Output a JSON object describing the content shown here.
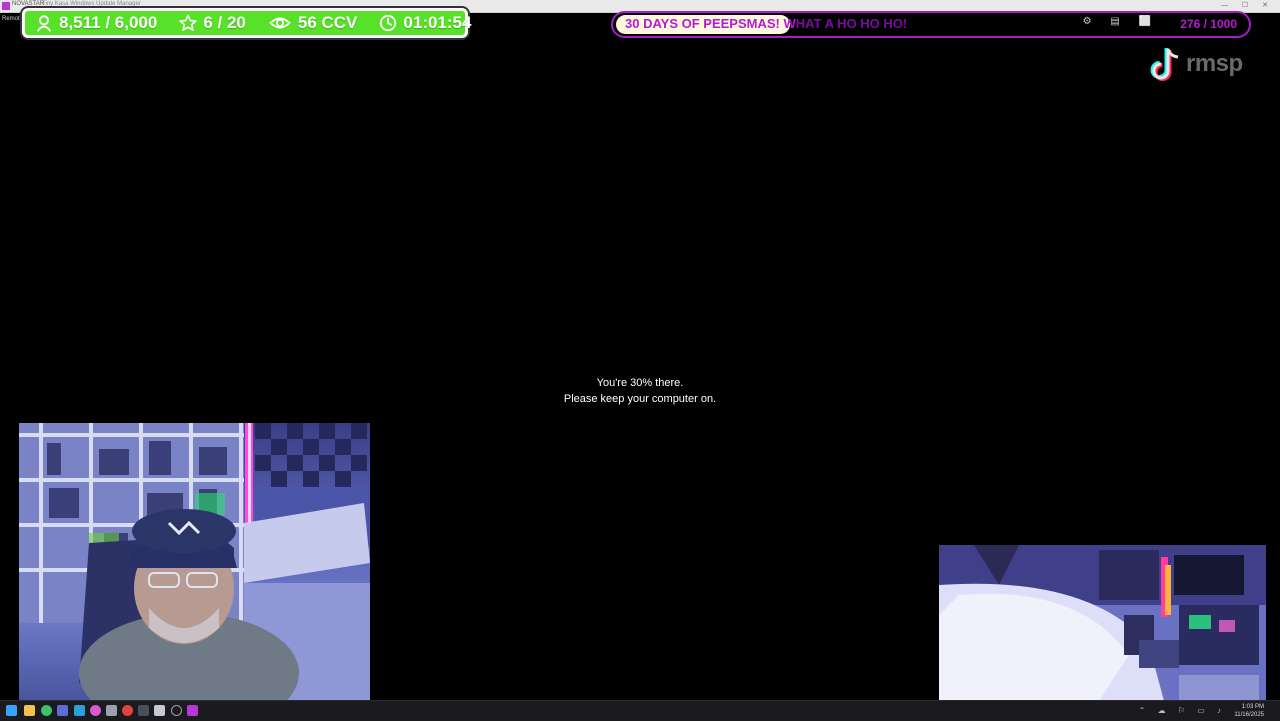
{
  "window": {
    "app_name": "NOVASTAR",
    "tab_title": "Tiny Kasa Windows Update Manager",
    "remote_label": "Remote D"
  },
  "stats": {
    "followers": "8,511 / 6,000",
    "goals": "6 / 20",
    "viewers": "56 CCV",
    "timer": "01:01:54",
    "color": "#57e128"
  },
  "banner": {
    "text_light": "30 DAYS OF PEEPSMAS! W",
    "text_dark": "HAT A HO HO HO!",
    "ticker": "276 / 1000",
    "color": "#b51bd2"
  },
  "watermark": {
    "handle": "rmsp"
  },
  "update": {
    "line1": "You're 30% there.",
    "line2": "Please keep your computer on.",
    "progress_percent": 30
  },
  "tray": {
    "time": "1:03 PM",
    "date": "11/16/2025"
  }
}
